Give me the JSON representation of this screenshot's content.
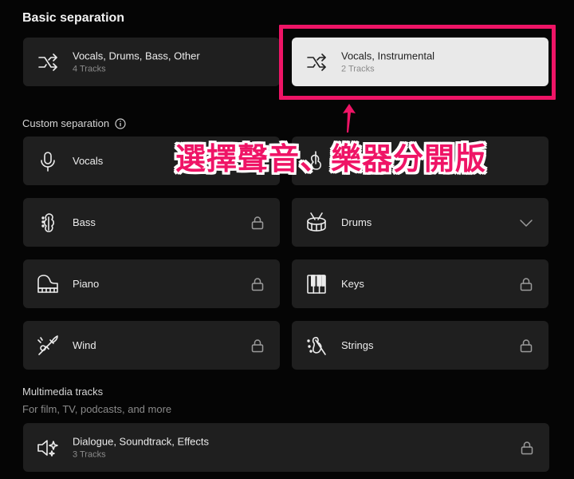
{
  "basic": {
    "title": "Basic separation",
    "options": [
      {
        "name": "Vocals, Drums, Bass, Other",
        "tracks": "4 Tracks"
      },
      {
        "name": "Vocals, Instrumental",
        "tracks": "2 Tracks"
      }
    ]
  },
  "custom": {
    "title": "Custom separation",
    "items": [
      {
        "name": "Vocals"
      },
      {
        "name": "Guitar"
      },
      {
        "name": "Bass"
      },
      {
        "name": "Drums"
      },
      {
        "name": "Piano"
      },
      {
        "name": "Keys"
      },
      {
        "name": "Wind"
      },
      {
        "name": "Strings"
      }
    ]
  },
  "multimedia": {
    "title": "Multimedia tracks",
    "hint": "For film, TV, podcasts, and more",
    "item": {
      "name": "Dialogue, Soundtrack, Effects",
      "tracks": "3 Tracks"
    }
  },
  "annotation": {
    "text": "選擇聲音、樂器分開版",
    "color": "#ef1466"
  },
  "colors": {
    "card": "#1f1f1f",
    "selected_card": "#e9e9e9",
    "accent": "#ef1466"
  }
}
